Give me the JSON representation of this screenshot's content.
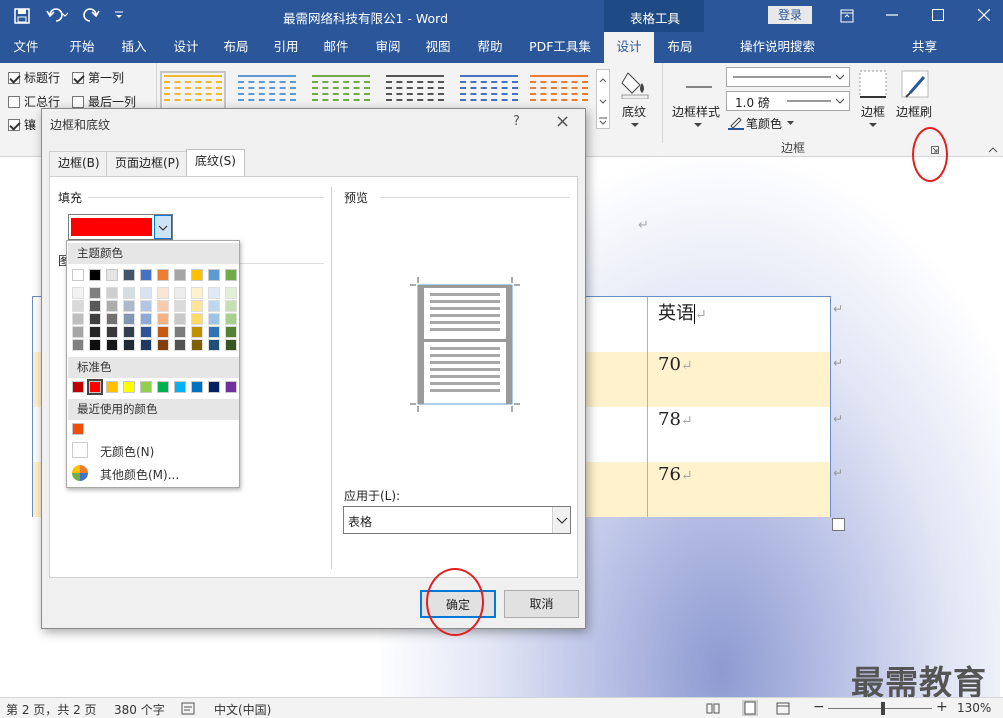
{
  "window": {
    "title": "最需网络科技有限公1  -  Word",
    "context_tab": "表格工具",
    "login_label": "登录"
  },
  "tabs": [
    "文件",
    "开始",
    "插入",
    "设计",
    "布局",
    "引用",
    "邮件",
    "审阅",
    "视图",
    "帮助",
    "PDF工具集",
    "设计",
    "布局"
  ],
  "tell_me": "操作说明搜索",
  "share_label": "共享",
  "ribbon": {
    "options": [
      {
        "label": "标题行",
        "checked": true
      },
      {
        "label": "第一列",
        "checked": true
      },
      {
        "label": "汇总行",
        "checked": false
      },
      {
        "label": "最后一列",
        "checked": false
      },
      {
        "label": "镶",
        "checked": true
      }
    ],
    "style_colors": [
      "#f2b830",
      "#5b9bd5",
      "#70ad47",
      "#555555",
      "#4472c4",
      "#ed7d31"
    ],
    "shading_label": "底纹",
    "border_styles_label": "边框样式",
    "line_weight": "1.0 磅",
    "pen_color_label": "笔颜色",
    "borders_label": "边框",
    "border_painter_label": "边框刷",
    "group_label": "边框"
  },
  "document": {
    "cells": [
      "英语",
      "70",
      "78",
      "76"
    ],
    "row_colors": [
      "#ffffff",
      "#fff2cc",
      "#ffffff",
      "#fff2cc"
    ]
  },
  "dialog": {
    "title": "边框和底纹",
    "help": "?",
    "close": "×",
    "tabs": [
      "边框(B)",
      "页面边框(P)",
      "底纹(S)"
    ],
    "fill_label": "填充",
    "fill_color": "#ff0000",
    "pattern_label_partial": "图",
    "preview_label": "预览",
    "apply_to_label": "应用于(L):",
    "apply_to_value": "表格",
    "ok": "确定",
    "cancel": "取消"
  },
  "palette": {
    "theme_header": "主题颜色",
    "theme_top": [
      "#ffffff",
      "#000000",
      "#e7e6e6",
      "#44546a",
      "#4472c4",
      "#ed7d31",
      "#a5a5a5",
      "#ffc000",
      "#5b9bd5",
      "#70ad47"
    ],
    "theme_shades": [
      [
        "#f2f2f2",
        "#d9d9d9",
        "#bfbfbf",
        "#a6a6a6",
        "#808080"
      ],
      [
        "#7f7f7f",
        "#595959",
        "#404040",
        "#262626",
        "#0d0d0d"
      ],
      [
        "#d0cece",
        "#aeabab",
        "#757070",
        "#3a3838",
        "#171616"
      ],
      [
        "#d6dce4",
        "#adb9ca",
        "#8497b0",
        "#333f4f",
        "#222a35"
      ],
      [
        "#d9e2f3",
        "#b4c6e7",
        "#8eaadb",
        "#2f5496",
        "#1f3864"
      ],
      [
        "#fbe5d5",
        "#f7cbac",
        "#f4b183",
        "#c55a11",
        "#833c0b"
      ],
      [
        "#ededed",
        "#dbdbdb",
        "#c9c9c9",
        "#7b7b7b",
        "#525252"
      ],
      [
        "#fff2cc",
        "#ffe599",
        "#ffd966",
        "#bf8f00",
        "#7f6000"
      ],
      [
        "#deebf6",
        "#bdd7ee",
        "#9dc3e6",
        "#2e75b5",
        "#1f4e79"
      ],
      [
        "#e2efd9",
        "#c5e0b3",
        "#a8d08d",
        "#538135",
        "#375623"
      ]
    ],
    "standard_header": "标准色",
    "standard": [
      "#c00000",
      "#ff0000",
      "#ffc000",
      "#ffff00",
      "#92d050",
      "#00b050",
      "#00b0f0",
      "#0070c0",
      "#002060",
      "#7030a0"
    ],
    "recent_header": "最近使用的颜色",
    "recent": [
      "#f04e0e"
    ],
    "no_color": "无颜色(N)",
    "more_colors": "其他颜色(M)..."
  },
  "status": {
    "page": "第 2 页，共 2 页",
    "words": "380 个字",
    "language": "中文(中国)",
    "zoom": "130%"
  },
  "watermark": "最需教育"
}
